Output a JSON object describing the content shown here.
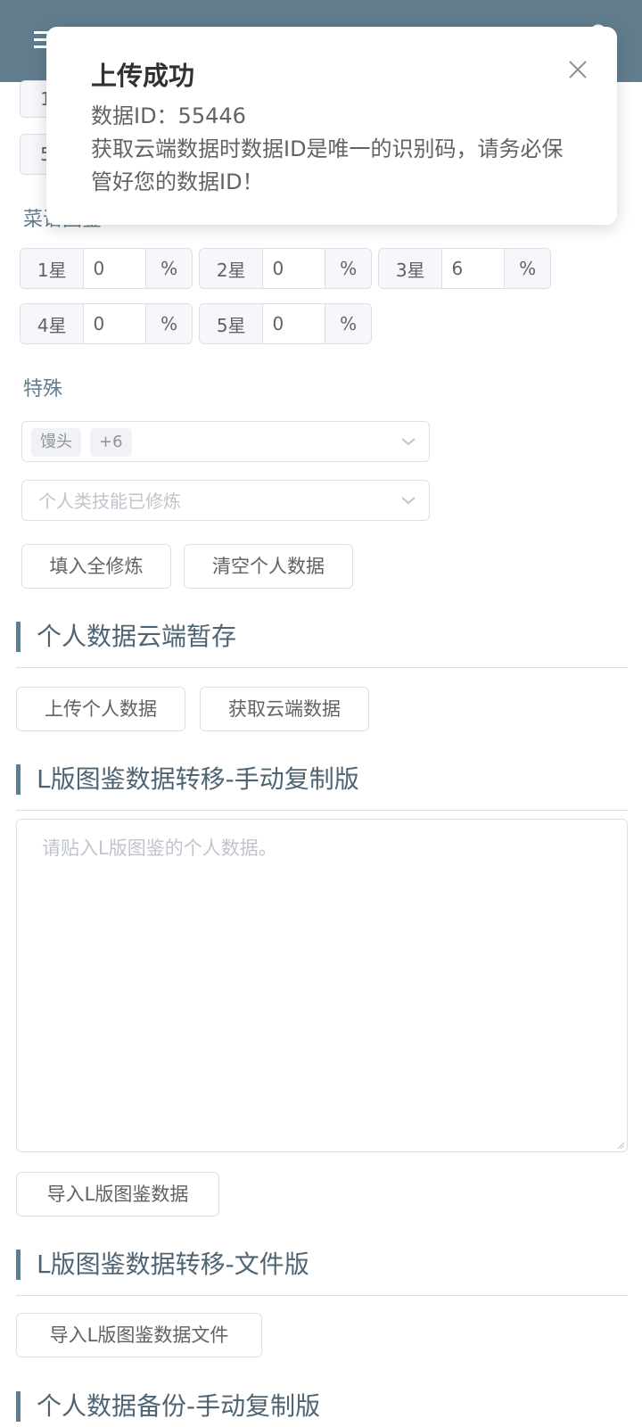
{
  "header": {
    "menu_icon": "menu-icon",
    "settings_icon": "settings-icon"
  },
  "partial_rows": {
    "row1_prefix": "1",
    "row2_prefix": "5"
  },
  "recipe_section_label": "菜谱图鉴",
  "recipe_stars": [
    {
      "prefix": "1星",
      "value": "0",
      "suffix": "%"
    },
    {
      "prefix": "2星",
      "value": "0",
      "suffix": "%"
    },
    {
      "prefix": "3星",
      "value": "6",
      "suffix": "%"
    },
    {
      "prefix": "4星",
      "value": "0",
      "suffix": "%"
    },
    {
      "prefix": "5星",
      "value": "0",
      "suffix": "%"
    }
  ],
  "special": {
    "label": "特殊",
    "select1_tag": "馒头",
    "select1_more": "+6",
    "select2_placeholder": "个人类技能已修炼"
  },
  "buttons": {
    "fill_all": "填入全修炼",
    "clear_personal": "清空个人数据",
    "upload_personal": "上传个人数据",
    "fetch_cloud": "获取云端数据",
    "import_l_data": "导入L版图鉴数据",
    "import_l_file": "导入L版图鉴数据文件"
  },
  "sections": {
    "cloud_temp": "个人数据云端暂存",
    "l_manual": "L版图鉴数据转移-手动复制版",
    "l_file": "L版图鉴数据转移-文件版",
    "backup_manual": "个人数据备份-手动复制版"
  },
  "textarea": {
    "placeholder": "请贴入L版图鉴的个人数据。"
  },
  "toast": {
    "title": "上传成功",
    "line1": "数据ID：55446",
    "line2": "获取云端数据时数据ID是唯一的识别码，请务必保管好您的数据ID！"
  },
  "colors": {
    "header_bg": "#617d8d",
    "accent": "#617d8d",
    "border": "#dcdfe6"
  }
}
